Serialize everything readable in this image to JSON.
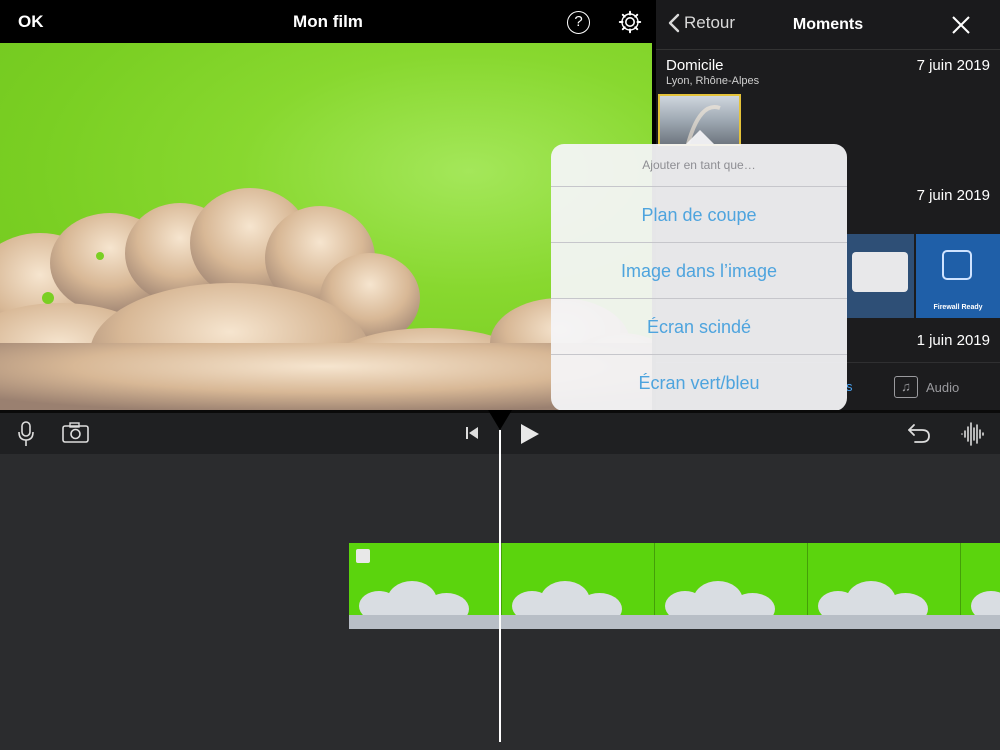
{
  "editor": {
    "ok_label": "OK",
    "title": "Mon film",
    "help_glyph": "?"
  },
  "panel": {
    "back_label": "Retour",
    "title": "Moments",
    "sections": [
      {
        "name": "Domicile",
        "subtitle": "Lyon, Rhône-Alpes",
        "date": "7 juin 2019"
      },
      {
        "name": "",
        "subtitle": "",
        "date": "7 juin 2019"
      },
      {
        "name": "",
        "subtitle": "",
        "date": "1 juin 2019"
      }
    ],
    "thumb_caption": "Firewall Ready",
    "tabs": {
      "partial_tab": "s",
      "audio_label": "Audio"
    }
  },
  "popover": {
    "title": "Ajouter en tant que…",
    "options": [
      "Plan de coupe",
      "Image dans l’image",
      "Écran scindé",
      "Écran vert/bleu"
    ]
  },
  "colors": {
    "accent_blue": "#4ea4de",
    "chroma_green": "#7acf23",
    "selection_yellow": "#e4c23a"
  },
  "icons": [
    "microphone-icon",
    "camera-icon",
    "skip-to-start-icon",
    "play-icon",
    "undo-icon",
    "waveform-icon",
    "help-icon",
    "gear-icon",
    "close-icon",
    "chevron-left-icon",
    "music-note-icon"
  ]
}
